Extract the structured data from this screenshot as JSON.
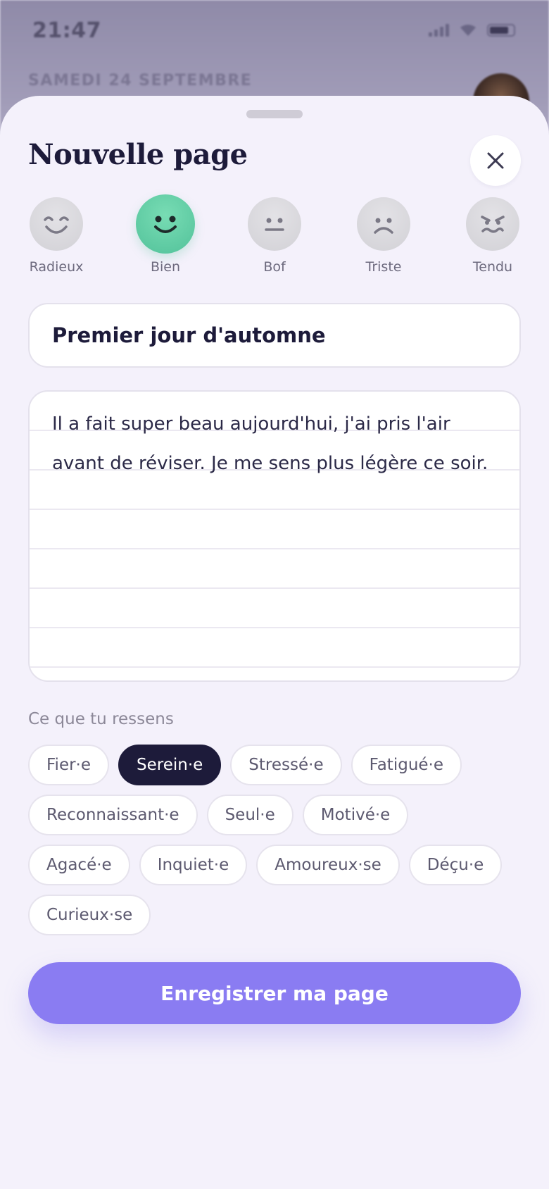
{
  "status_bar": {
    "time": "21:47"
  },
  "background": {
    "date": "SAMEDI 24 SEPTEMBRE"
  },
  "sheet": {
    "title": "Nouvelle page",
    "moods": [
      {
        "label": "Radieux",
        "icon": "beaming-face-icon",
        "selected": false
      },
      {
        "label": "Bien",
        "icon": "smiling-face-icon",
        "selected": true
      },
      {
        "label": "Bof",
        "icon": "neutral-face-icon",
        "selected": false
      },
      {
        "label": "Triste",
        "icon": "sad-face-icon",
        "selected": false
      },
      {
        "label": "Tendu",
        "icon": "tense-face-icon",
        "selected": false
      }
    ],
    "entry_title": "Premier jour d'automne",
    "entry_body": "Il a fait super beau aujourd'hui, j'ai pris l'air avant de réviser. Je me sens plus légère ce soir.",
    "feelings_label": "Ce que tu ressens",
    "feelings": [
      {
        "label": "Fier·e",
        "selected": false
      },
      {
        "label": "Serein·e",
        "selected": true
      },
      {
        "label": "Stressé·e",
        "selected": false
      },
      {
        "label": "Fatigué·e",
        "selected": false
      },
      {
        "label": "Reconnaissant·e",
        "selected": false
      },
      {
        "label": "Seul·e",
        "selected": false
      },
      {
        "label": "Motivé·e",
        "selected": false
      },
      {
        "label": "Agacé·e",
        "selected": false
      },
      {
        "label": "Inquiet·e",
        "selected": false
      },
      {
        "label": "Amoureux·se",
        "selected": false
      },
      {
        "label": "Déçu·e",
        "selected": false
      },
      {
        "label": "Curieux·se",
        "selected": false
      }
    ],
    "save_label": "Enregistrer ma page"
  },
  "colors": {
    "accent": "#8a7cf2",
    "mood_selected": "#5fcfa5",
    "chip_selected": "#1d1b3a",
    "title_text": "#1d1b3a"
  }
}
